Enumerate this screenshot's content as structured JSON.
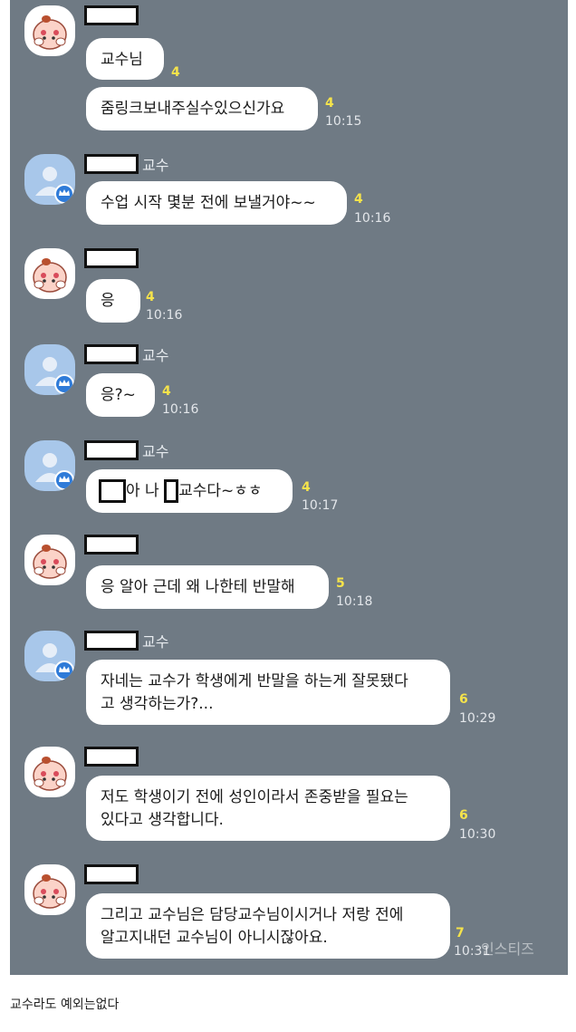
{
  "messages": [
    {
      "text": "교수님",
      "unread": "4",
      "time": ""
    },
    {
      "text": "줌링크보내주실수있으신가요",
      "unread": "4",
      "time": "10:15"
    },
    {
      "sender_suffix": "교수",
      "text": "수업 시작 몇분 전에 보낼거야~~",
      "unread": "4",
      "time": "10:16"
    },
    {
      "text": "응",
      "unread": "4",
      "time": "10:16"
    },
    {
      "sender_suffix": "교수",
      "text": "응?~",
      "unread": "4",
      "time": "10:16"
    },
    {
      "sender_suffix": "교수",
      "text_a": "아 나",
      "text_b": "교수다~ㅎㅎ",
      "unread": "4",
      "time": "10:17"
    },
    {
      "text": "응 알아 근데 왜 나한테 반말해",
      "unread": "5",
      "time": "10:18"
    },
    {
      "sender_suffix": "교수",
      "text": "자네는 교수가 학생에게 반말을 하는게 잘못됐다\n고 생각하는가?...",
      "unread": "6",
      "time": "10:29"
    },
    {
      "text": "저도 학생이기 전에 성인이라서 존중받을 필요는\n있다고 생각합니다.",
      "unread": "6",
      "time": "10:30"
    },
    {
      "text": "그리고 교수님은 담당교수님이시거나 저랑 전에\n알고지내던 교수님이 아니시잖아요.",
      "unread": "7",
      "time": "10:31"
    }
  ],
  "watermark": "인스티즈",
  "caption": "교수라도 예외는없다",
  "colors": {
    "chat_bg": "#6f7a84",
    "unread": "#f5e34b",
    "bubble": "#ffffff"
  }
}
